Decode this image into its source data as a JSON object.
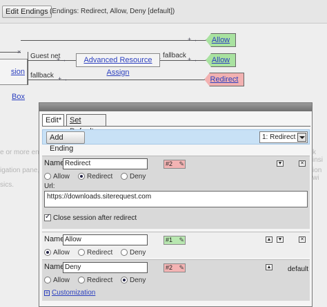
{
  "toolbar": {
    "edit_endings_label": "Edit Endings",
    "endings_summary": "(Endings: Redirect, Allow, Deny [default])"
  },
  "flow": {
    "session_box_label": "sion Box",
    "advanced_box_label": "Advanced Resource Assign",
    "guest_label": "Guest net",
    "fallback1_label": "fallback",
    "fallback2_label": "fallback",
    "allow1_label": "Allow",
    "allow2_label": "Allow",
    "redirect_label": "Redirect",
    "bg_text_1": "e or more end",
    "bg_text_2": "igation pane,",
    "bg_text_3": "sics.",
    "bg_text_right_1": "k insi",
    "bg_text_right_2": "ion wi"
  },
  "panel": {
    "tabs": [
      {
        "label": "Edit*"
      },
      {
        "label": "Set Default"
      }
    ],
    "add_ending_label": "Add Ending",
    "selected_ending": "1: Redirect",
    "endings": [
      {
        "name_label": "Name:",
        "name": "Redirect",
        "badge": "#2",
        "radios": [
          "Allow",
          "Redirect",
          "Deny"
        ],
        "selected": "Redirect",
        "url_label": "Url:",
        "url": "https://downloads.siterequest.com",
        "checkbox_label": "Close session after redirect"
      },
      {
        "name_label": "Name:",
        "name": "Allow",
        "badge": "#1",
        "radios": [
          "Allow",
          "Redirect",
          "Deny"
        ],
        "selected": "Allow"
      },
      {
        "name_label": "Name:",
        "name": "Deny",
        "badge": "#2",
        "radios": [
          "Allow",
          "Redirect",
          "Deny"
        ],
        "selected": "Deny",
        "default_label": "default",
        "customization_label": "Customization"
      }
    ]
  },
  "colors": {
    "allow_fill": "#a9e2a0",
    "deny_fill": "#f2b1b1",
    "toolbar_fill": "#c8e1f6",
    "link": "#2b3fbf"
  },
  "icons": [
    "wand-icon",
    "dropdown-arrow-icon",
    "close-icon",
    "up-arrow-icon",
    "down-arrow-icon",
    "plus-icon"
  ]
}
